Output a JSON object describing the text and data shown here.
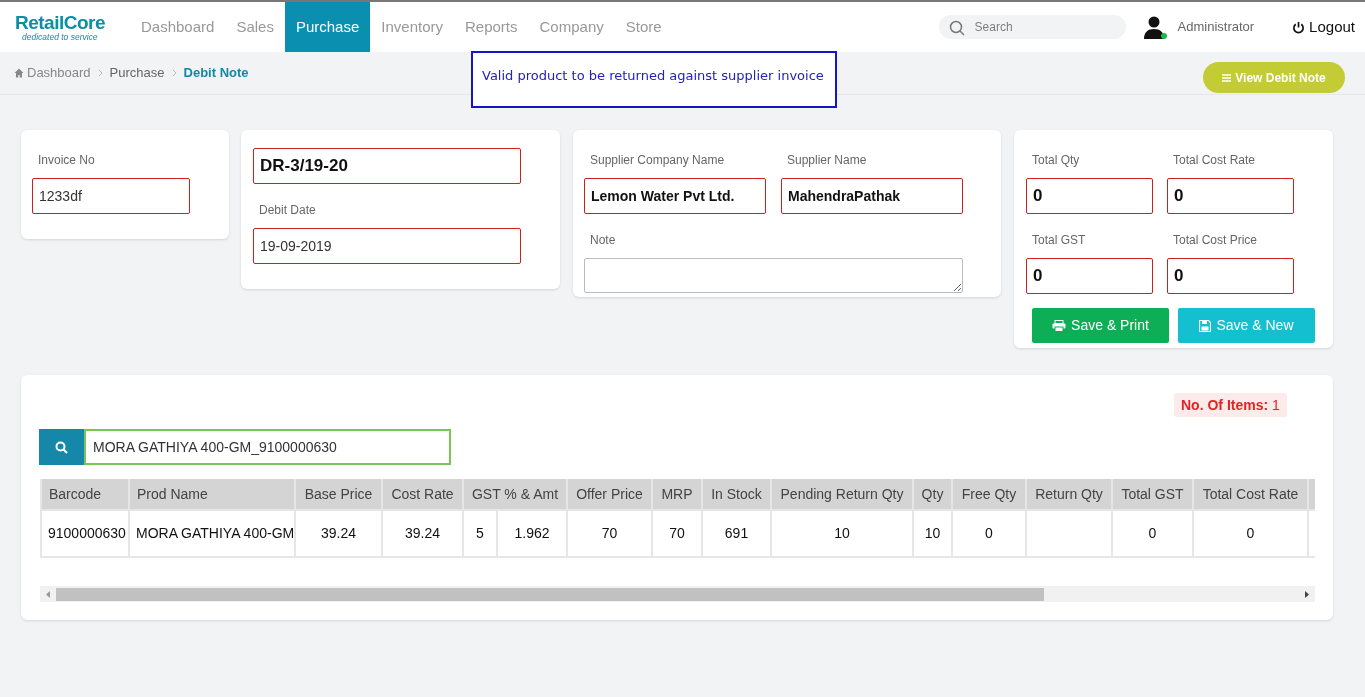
{
  "brand": {
    "name": "RetailCore",
    "tagline": "dedicated to service"
  },
  "nav": [
    {
      "label": "Dashboard",
      "selected": false
    },
    {
      "label": "Sales",
      "selected": false
    },
    {
      "label": "Purchase",
      "selected": true
    },
    {
      "label": "Inventory",
      "selected": false
    },
    {
      "label": "Reports",
      "selected": false
    },
    {
      "label": "Company",
      "selected": false
    },
    {
      "label": "Store",
      "selected": false
    }
  ],
  "search": {
    "placeholder": "Search"
  },
  "user": {
    "name": "Administrator",
    "online": true
  },
  "logout": "Logout",
  "breadcrumb": [
    "Dashboard",
    "Purchase",
    "Debit Note"
  ],
  "tooltip": "Valid product to be returned against supplier invoice",
  "view_button": "View Debit Note",
  "invoice": {
    "label": "Invoice No",
    "value": "1233df"
  },
  "debit": {
    "number": "DR-3/19-20",
    "date_label": "Debit Date",
    "date": "19-09-2019"
  },
  "supplier": {
    "company_label": "Supplier Company Name",
    "company": "Lemon Water Pvt Ltd.",
    "name_label": "Supplier Name",
    "name": "MahendraPathak",
    "note_label": "Note"
  },
  "totals": [
    {
      "label": "Total Qty",
      "value": "0"
    },
    {
      "label": "Total Cost Rate",
      "value": "0"
    },
    {
      "label": "Total GST",
      "value": "0"
    },
    {
      "label": "Total Cost Price",
      "value": "0"
    }
  ],
  "buttons": [
    {
      "label": "Save & Print",
      "kind": "print"
    },
    {
      "label": "Save & New",
      "kind": "save"
    }
  ],
  "items_count": {
    "label": "No. Of Items:",
    "value": "1"
  },
  "product_search": {
    "value": "MORA GATHIYA 400-GM_9100000630"
  },
  "table": {
    "columns": [
      "Barcode",
      "Prod Name",
      "Base Price",
      "Cost Rate",
      "GST % & Amt",
      "Offer Price",
      "MRP",
      "In Stock",
      "Pending Return Qty",
      "Qty",
      "Free Qty",
      "Return Qty",
      "Total GST",
      "Total Cost Rate"
    ],
    "rows": [
      [
        "9100000630",
        "MORA GATHIYA 400-GM",
        "39.24",
        "39.24",
        [
          "5",
          "1.962"
        ],
        "70",
        "70",
        "691",
        "10",
        "10",
        "0",
        null,
        "0",
        "0"
      ]
    ]
  }
}
